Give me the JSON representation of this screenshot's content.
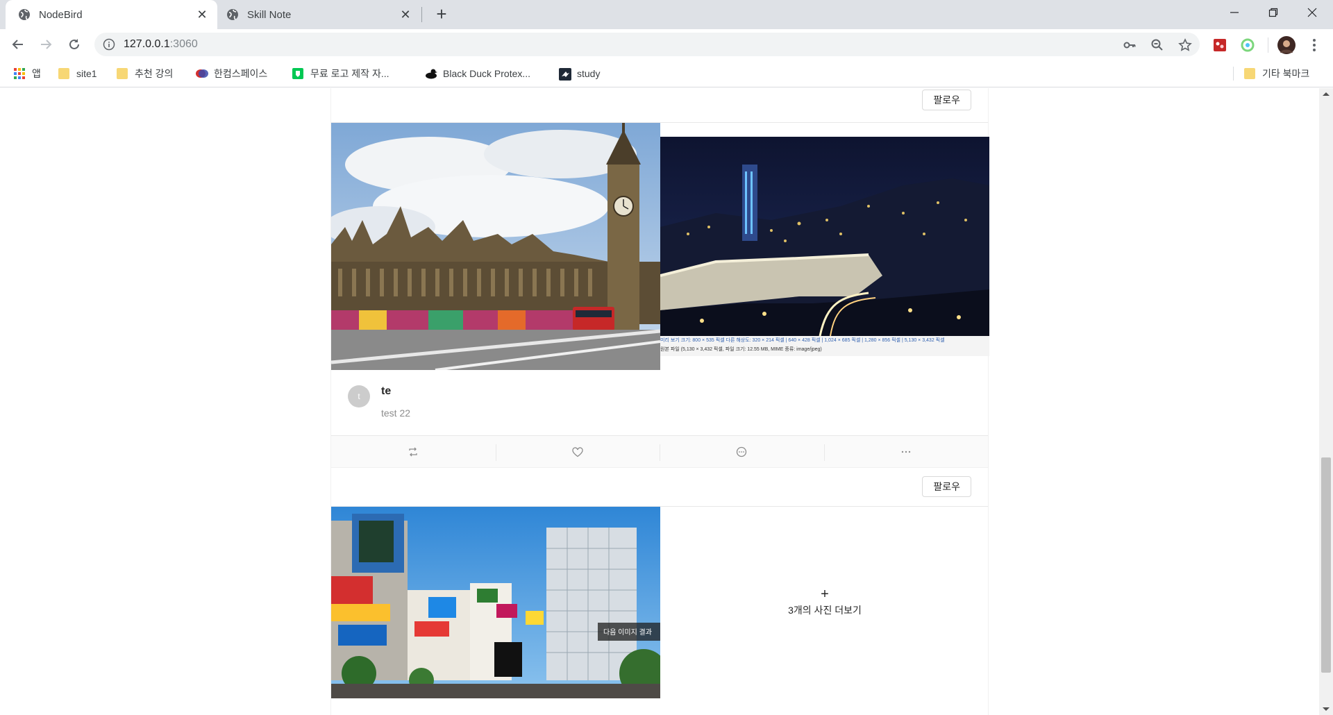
{
  "browser": {
    "tabs": [
      {
        "title": "NodeBird",
        "active": true
      },
      {
        "title": "Skill Note",
        "active": false
      }
    ],
    "address": {
      "host": "127.0.0.1",
      "port": ":3060"
    },
    "bookmarks": [
      {
        "label": "앱",
        "icon": "apps-grid-icon"
      },
      {
        "label": "site1",
        "icon": "folder-icon"
      },
      {
        "label": "추천 강의",
        "icon": "folder-icon"
      },
      {
        "label": "한컴스페이스",
        "icon": "hancom-icon"
      },
      {
        "label": "무료 로고 제작 자...",
        "icon": "logo-maker-icon"
      },
      {
        "label": "Black Duck Protex...",
        "icon": "black-duck-icon"
      },
      {
        "label": "study",
        "icon": "study-icon"
      }
    ],
    "other_bookmarks": "기타 북마크"
  },
  "feed": {
    "posts": [
      {
        "follow_label": "팔로우",
        "images": [
          "big-ben-london-photo",
          "seoul-night-city-photo"
        ],
        "image_caption_lines": [
          "미리 보기 크기: 800 × 535 픽셀 다른 해상도: 320 × 214 픽셀 | 640 × 428 픽셀 | 1,024 × 685 픽셀 | 1,280 × 856 픽셀 | 5,130 × 3,432 픽셀",
          "원본 파일 (5,130 × 3,432 픽셀, 파일 크기: 12.55 MB, MIME 종류: image/jpeg)"
        ],
        "avatar_initial": "t",
        "author": "te",
        "content": "test 22",
        "actions": [
          "retweet-icon",
          "heart-icon",
          "message-icon",
          "ellipsis-icon"
        ]
      },
      {
        "follow_label": "팔로우",
        "images": [
          "shibuya-crossing-photo"
        ],
        "image_overlay_text": "다음 이미지 결과",
        "more_photos_label": "3개의 사진 더보기"
      }
    ]
  },
  "colors": {
    "tab_strip": "#dee1e6",
    "omnibox": "#f1f3f4",
    "action_bar": "#fafafa",
    "border": "#e8e8e8"
  }
}
